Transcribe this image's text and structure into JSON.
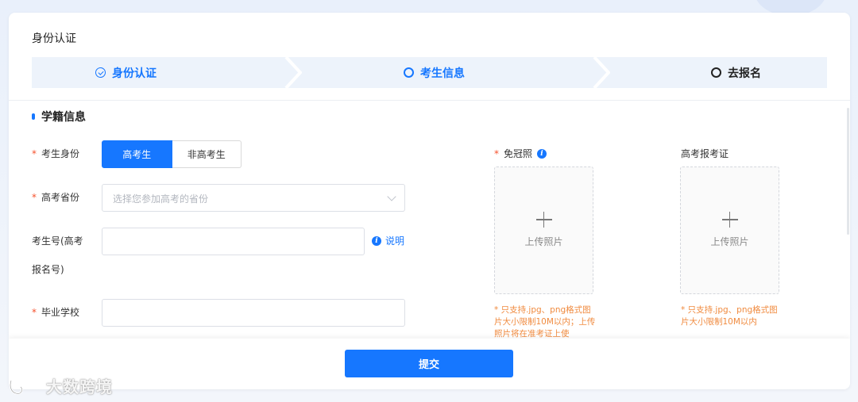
{
  "card": {
    "title": "身份认证"
  },
  "steps": [
    {
      "label": "身份认证",
      "state": "done"
    },
    {
      "label": "考生信息",
      "state": "active"
    },
    {
      "label": "去报名",
      "state": "pending"
    }
  ],
  "section": {
    "title": "学籍信息"
  },
  "form": {
    "identity": {
      "required_mark": "*",
      "label": "考生身份",
      "options": [
        "高考生",
        "非高考生"
      ],
      "selected": "高考生"
    },
    "province": {
      "required_mark": "*",
      "label": "高考省份",
      "placeholder": "选择您参加高考的省份",
      "value": ""
    },
    "exam_no": {
      "label_line1": "考生号(高考",
      "label_line2": "报名号)",
      "value": "",
      "help_text": "说明"
    },
    "school": {
      "required_mark": "*",
      "label": "毕业学校",
      "value": ""
    }
  },
  "uploads": {
    "photo": {
      "required_mark": "*",
      "label": "免冠照",
      "button_text": "上传照片",
      "hint": "* 只支持.jpg、png格式图片大小限制10M以内；上传照片将在准考证上使"
    },
    "admission": {
      "label": "高考报考证",
      "button_text": "上传照片",
      "hint": "* 只支持.jpg、png格式图片大小限制10M以内"
    }
  },
  "footer": {
    "submit_label": "提交"
  },
  "watermark": {
    "text": "大数跨境"
  },
  "colors": {
    "primary": "#1677ff",
    "hint": "#f08a3e",
    "required": "#f5512c"
  }
}
